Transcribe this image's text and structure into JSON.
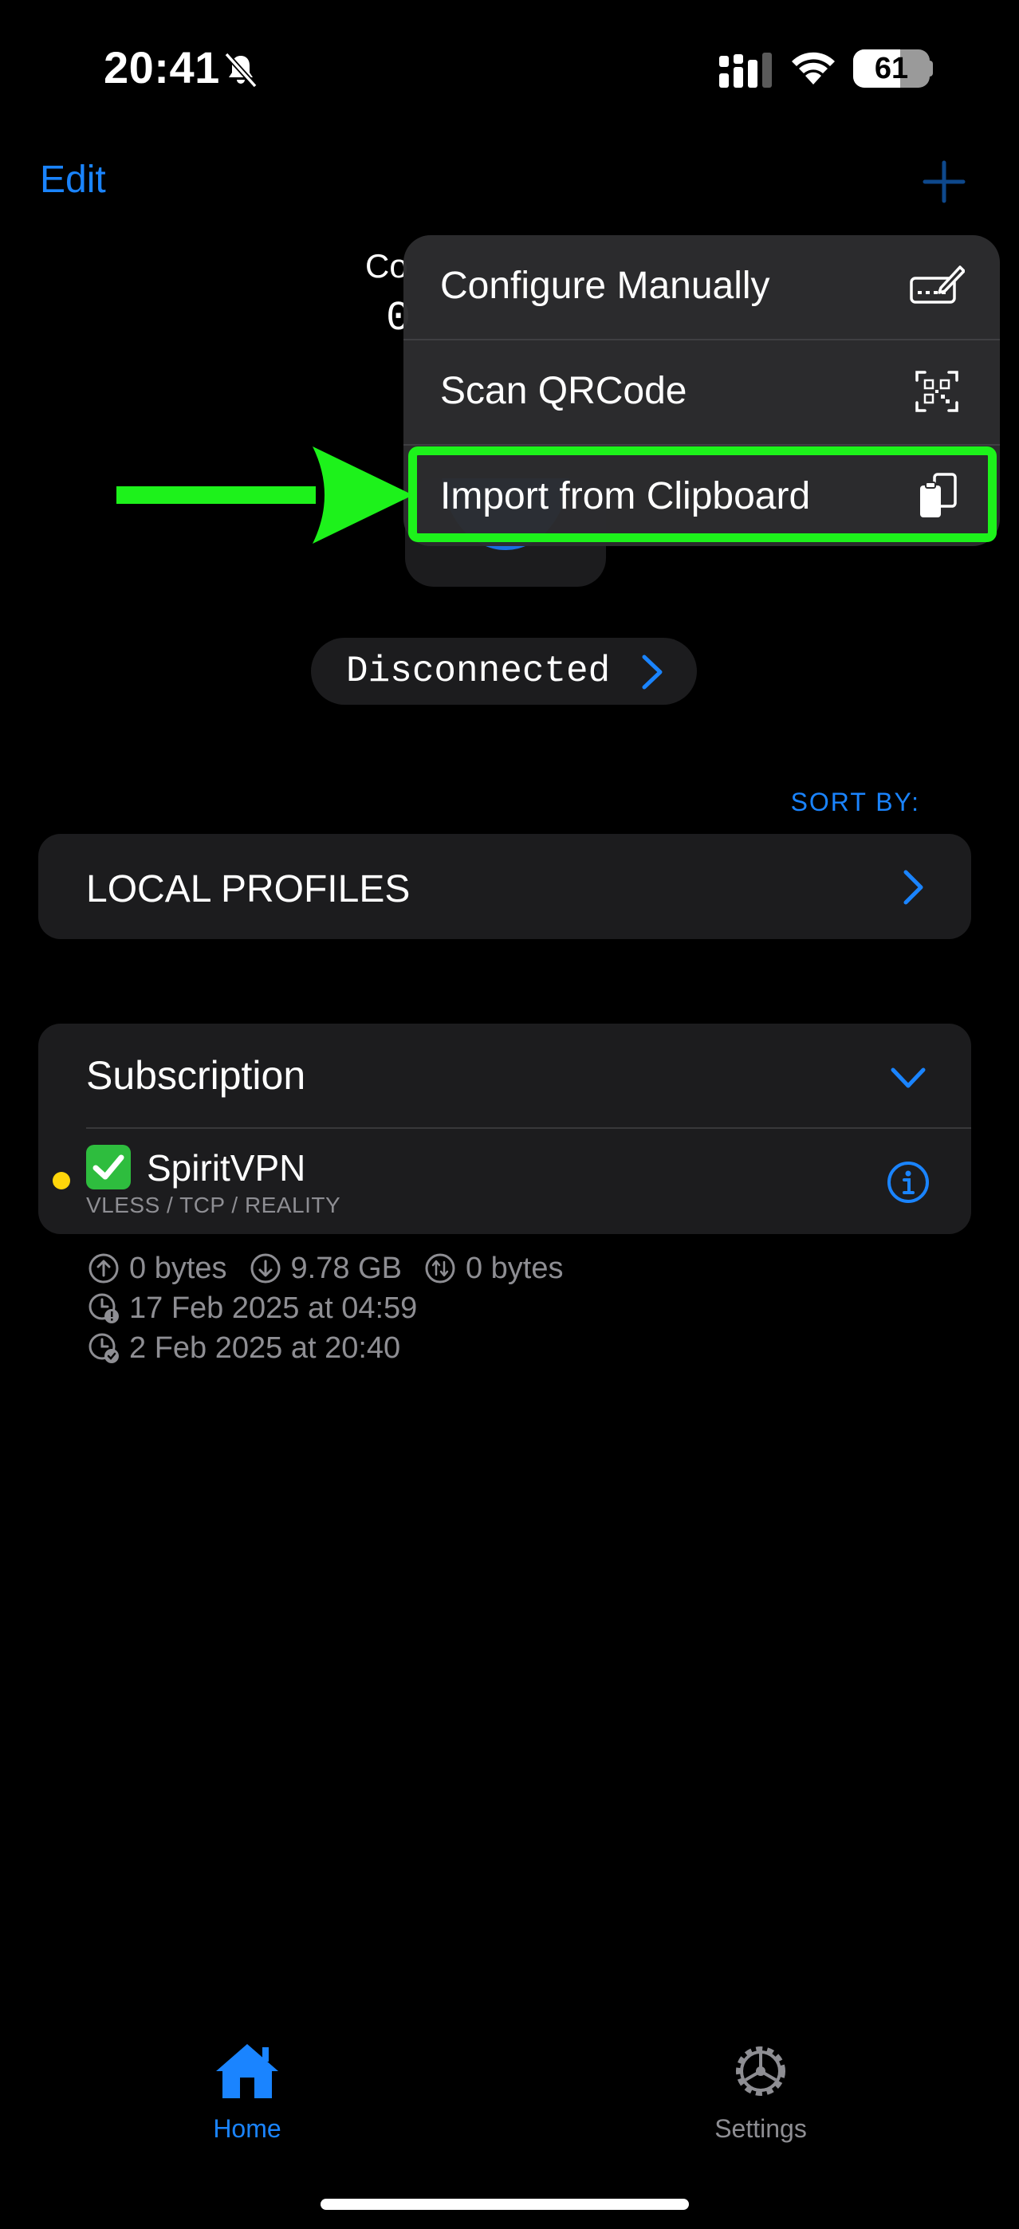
{
  "status_bar": {
    "time": "20:41",
    "battery": "61",
    "battery_level": 0.61
  },
  "nav": {
    "edit_label": "Edit"
  },
  "background": {
    "connection_label": "Co",
    "connection_value": "0"
  },
  "menu": {
    "items": [
      {
        "label": "Configure Manually",
        "icon": "keyboard-pen-icon"
      },
      {
        "label": "Scan QRCode",
        "icon": "qrcode-scan-icon"
      },
      {
        "label": "Import from Clipboard",
        "icon": "clipboard-icon"
      }
    ]
  },
  "status_pill": {
    "label": "Disconnected"
  },
  "sort": {
    "label": "SORT BY:"
  },
  "local_profiles": {
    "label": "LOCAL PROFILES"
  },
  "subscription": {
    "title": "Subscription",
    "profile": {
      "emoji": "✅",
      "name": "SpiritVPN",
      "protocol": "VLESS / TCP / REALITY"
    },
    "stats": {
      "upload": "0 bytes",
      "download": "9.78 GB",
      "total": "0 bytes",
      "expires": "17 Feb 2025 at 04:59",
      "updated": "2 Feb 2025 at 20:40"
    }
  },
  "tabs": [
    {
      "label": "Home",
      "icon": "house-icon",
      "active": true
    },
    {
      "label": "Settings",
      "icon": "gear-icon",
      "active": false
    }
  ],
  "colors": {
    "accent": "#1a84ff",
    "highlight": "#1df21b",
    "dot": "#ffd60a",
    "inactive": "#8e8e93"
  }
}
